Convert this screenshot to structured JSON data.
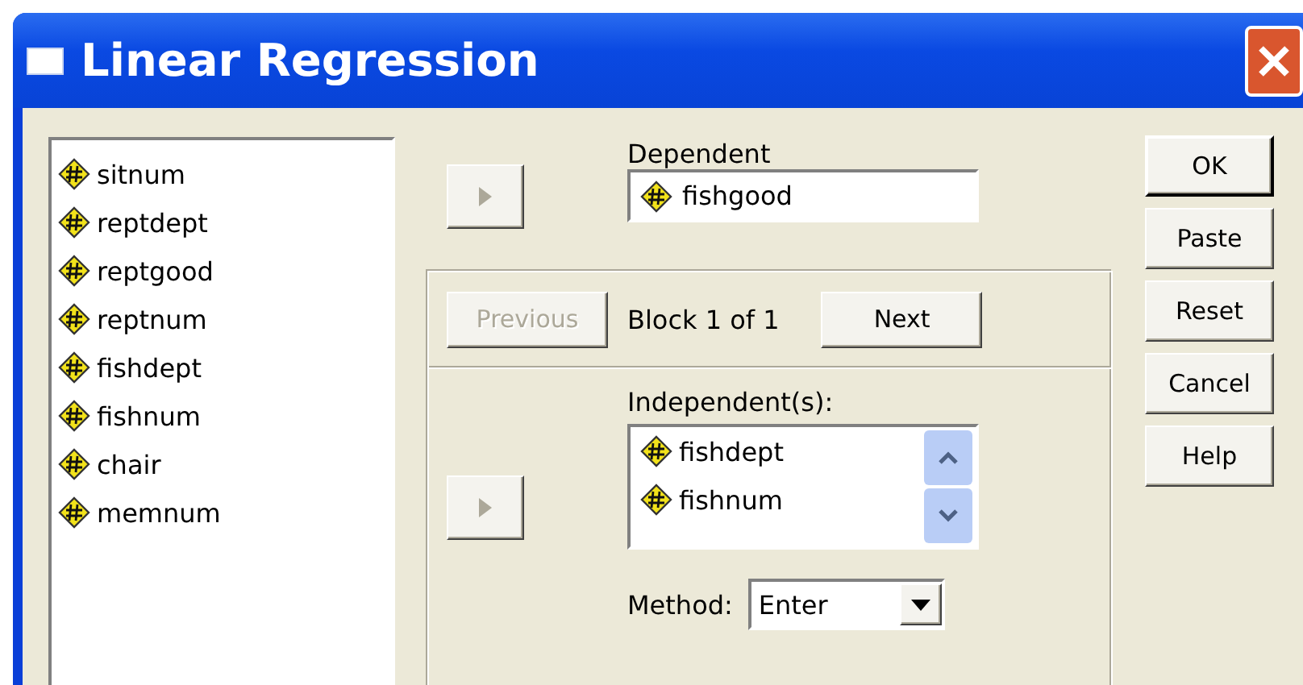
{
  "window": {
    "title": "Linear Regression"
  },
  "variables": [
    {
      "name": "sitnum"
    },
    {
      "name": "reptdept"
    },
    {
      "name": "reptgood"
    },
    {
      "name": "reptnum"
    },
    {
      "name": "fishdept"
    },
    {
      "name": "fishnum"
    },
    {
      "name": "chair"
    },
    {
      "name": "memnum"
    }
  ],
  "dependent": {
    "label": "Dependent",
    "move_button": {
      "disabled": true
    },
    "value": "fishgood"
  },
  "block": {
    "previous": {
      "label": "Previous",
      "disabled": true
    },
    "text": "Block 1 of 1",
    "next": {
      "label": "Next",
      "disabled": false
    }
  },
  "independents": {
    "label": "Independent(s):",
    "move_button": {
      "disabled": true
    },
    "items": [
      {
        "name": "fishdept"
      },
      {
        "name": "fishnum"
      }
    ]
  },
  "method": {
    "label": "Method:",
    "value": "Enter"
  },
  "buttons": [
    {
      "label": "OK",
      "default": true
    },
    {
      "label": "Paste",
      "default": false
    },
    {
      "label": "Reset",
      "default": false
    },
    {
      "label": "Cancel",
      "default": false
    },
    {
      "label": "Help",
      "default": false
    }
  ]
}
